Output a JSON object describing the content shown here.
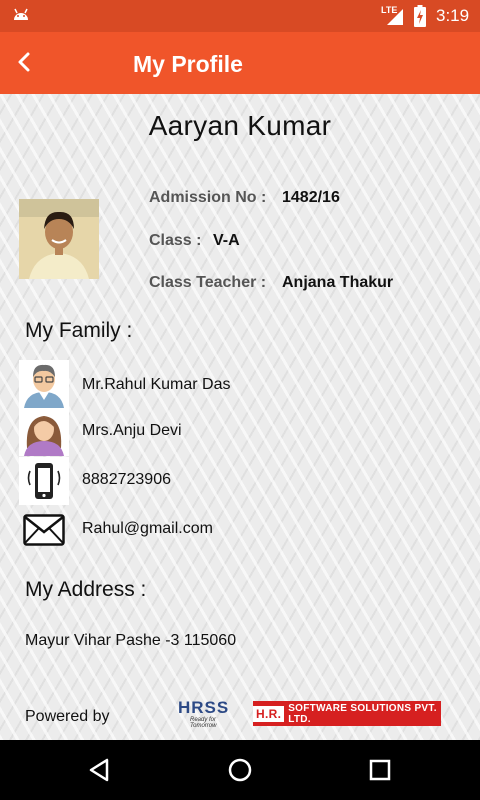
{
  "status_bar": {
    "network": "LTE",
    "time": "3:19"
  },
  "app_bar": {
    "title": "My Profile"
  },
  "profile": {
    "name": "Aaryan  Kumar",
    "admission_label": "Admission No :",
    "admission_value": "1482/16",
    "class_label": "Class :",
    "class_value": "V-A",
    "teacher_label": "Class Teacher :",
    "teacher_value": "Anjana Thakur"
  },
  "family": {
    "title": "My Family :",
    "father": "Mr.Rahul Kumar Das",
    "mother": "Mrs.Anju Devi",
    "phone": "8882723906",
    "email": "Rahul@gmail.com"
  },
  "address": {
    "title": "My Address :",
    "value": "Mayur Vihar Pashe -3 115060"
  },
  "footer": {
    "powered_by": "Powered by",
    "hrss_logo": "HRSS",
    "hrss_tagline": "Ready for Tomorrow",
    "company_badge": "H.R.",
    "company_text": "SOFTWARE SOLUTIONS PVT. LTD."
  },
  "colors": {
    "status_bar": "#d84a24",
    "app_bar": "#f0552a",
    "brand_red": "#d62020"
  },
  "icons": [
    "android-icon",
    "lte-signal-icon",
    "battery-icon",
    "back-arrow-icon",
    "father-avatar-icon",
    "mother-avatar-icon",
    "phone-icon",
    "email-icon",
    "nav-back-icon",
    "nav-home-icon",
    "nav-recents-icon"
  ]
}
